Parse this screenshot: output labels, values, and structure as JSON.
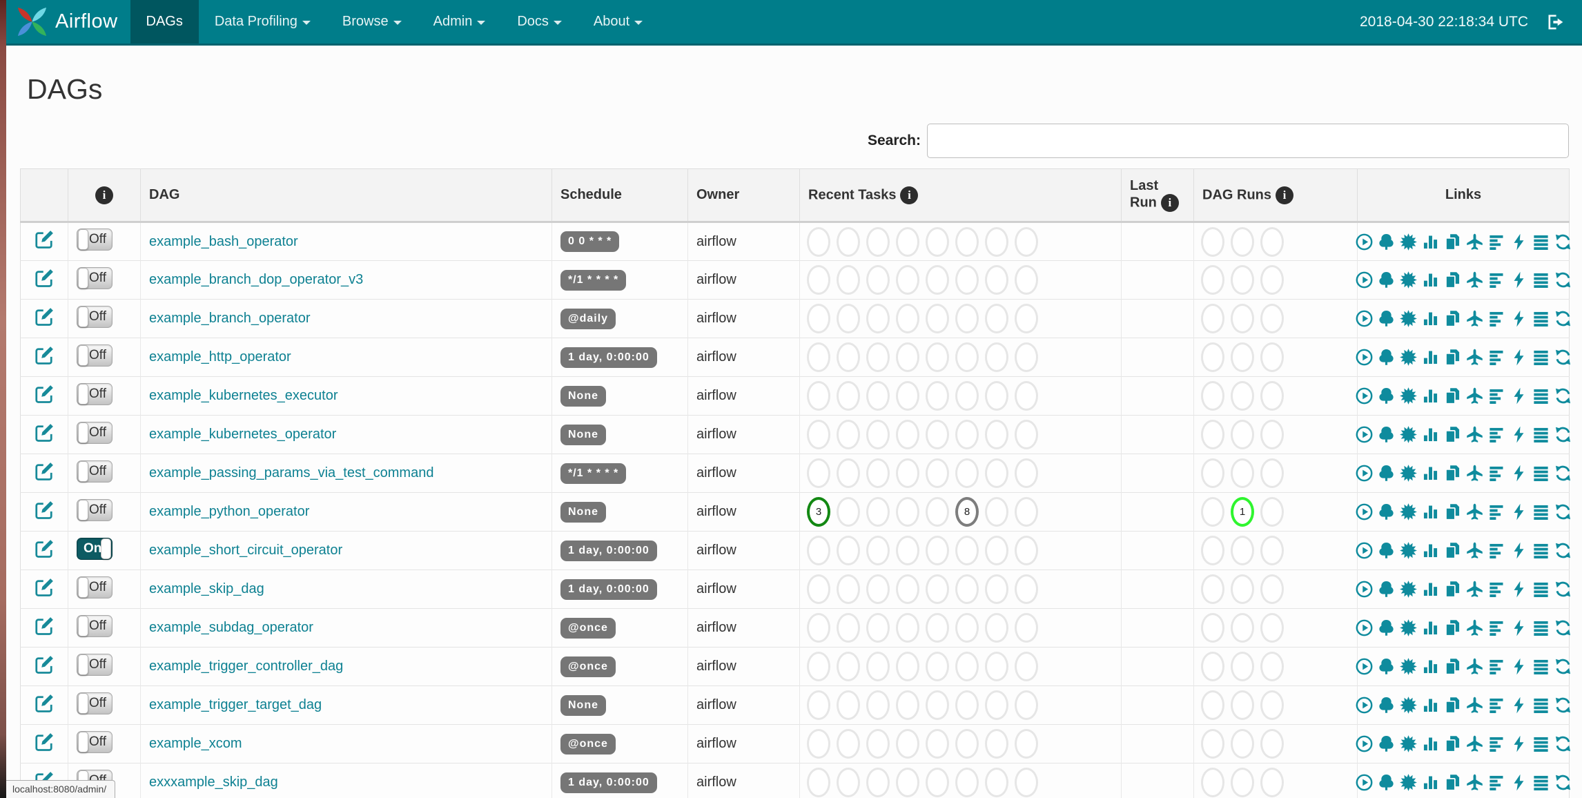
{
  "page": {
    "title": "DAGs",
    "status_bar_url": "localhost:8080/admin/"
  },
  "navbar": {
    "brand": "Airflow",
    "items": [
      {
        "label": "DAGs",
        "active": true,
        "caret": false
      },
      {
        "label": "Data Profiling",
        "active": false,
        "caret": true
      },
      {
        "label": "Browse",
        "active": false,
        "caret": true
      },
      {
        "label": "Admin",
        "active": false,
        "caret": true
      },
      {
        "label": "Docs",
        "active": false,
        "caret": true
      },
      {
        "label": "About",
        "active": false,
        "caret": true
      }
    ],
    "clock": "2018-04-30 22:18:34 UTC",
    "colors": {
      "background": "#007d8a",
      "active_background": "#00565f"
    }
  },
  "search": {
    "label": "Search:",
    "value": ""
  },
  "table": {
    "headers": {
      "dag": "DAG",
      "schedule": "Schedule",
      "owner": "Owner",
      "recent_tasks": "Recent Tasks",
      "last_run": "Last Run",
      "dag_runs": "DAG Runs",
      "links": "Links"
    },
    "toggle_labels": {
      "on": "On",
      "off": "Off"
    },
    "recent_task_slots": 8,
    "dag_run_slots": 3,
    "links": [
      {
        "name": "trigger-dag",
        "icon": "play-circle"
      },
      {
        "name": "tree-view",
        "icon": "tree"
      },
      {
        "name": "graph-view",
        "icon": "sun"
      },
      {
        "name": "task-duration",
        "icon": "bar-chart"
      },
      {
        "name": "task-tries",
        "icon": "copy"
      },
      {
        "name": "landing-times",
        "icon": "plane"
      },
      {
        "name": "gantt-view",
        "icon": "gantt"
      },
      {
        "name": "code-view",
        "icon": "bolt"
      },
      {
        "name": "logs",
        "icon": "menu"
      },
      {
        "name": "refresh",
        "icon": "refresh"
      }
    ],
    "state_colors": {
      "success": "#138813",
      "queued": "#7d7d7d",
      "running": "#2ff52f",
      "empty": "#e6e6e6"
    },
    "rows": [
      {
        "dag": "example_bash_operator",
        "schedule": "0 0 * * *",
        "owner": "airflow",
        "enabled": false,
        "recent_tasks": [],
        "dag_runs": []
      },
      {
        "dag": "example_branch_dop_operator_v3",
        "schedule": "*/1 * * * *",
        "owner": "airflow",
        "enabled": false,
        "recent_tasks": [],
        "dag_runs": []
      },
      {
        "dag": "example_branch_operator",
        "schedule": "@daily",
        "owner": "airflow",
        "enabled": false,
        "recent_tasks": [],
        "dag_runs": []
      },
      {
        "dag": "example_http_operator",
        "schedule": "1 day, 0:00:00",
        "owner": "airflow",
        "enabled": false,
        "recent_tasks": [],
        "dag_runs": []
      },
      {
        "dag": "example_kubernetes_executor",
        "schedule": "None",
        "owner": "airflow",
        "enabled": false,
        "recent_tasks": [],
        "dag_runs": []
      },
      {
        "dag": "example_kubernetes_operator",
        "schedule": "None",
        "owner": "airflow",
        "enabled": false,
        "recent_tasks": [],
        "dag_runs": []
      },
      {
        "dag": "example_passing_params_via_test_command",
        "schedule": "*/1 * * * *",
        "owner": "airflow",
        "enabled": false,
        "recent_tasks": [],
        "dag_runs": []
      },
      {
        "dag": "example_python_operator",
        "schedule": "None",
        "owner": "airflow",
        "enabled": false,
        "recent_tasks": [
          {
            "slot": 1,
            "count": "3",
            "state": "success",
            "color": "#138813"
          },
          {
            "slot": 6,
            "count": "8",
            "state": "queued",
            "color": "#7d7d7d"
          }
        ],
        "dag_runs": [
          {
            "slot": 2,
            "count": "1",
            "state": "running",
            "color": "#2ff52f"
          }
        ]
      },
      {
        "dag": "example_short_circuit_operator",
        "schedule": "1 day, 0:00:00",
        "owner": "airflow",
        "enabled": true,
        "recent_tasks": [],
        "dag_runs": []
      },
      {
        "dag": "example_skip_dag",
        "schedule": "1 day, 0:00:00",
        "owner": "airflow",
        "enabled": false,
        "recent_tasks": [],
        "dag_runs": []
      },
      {
        "dag": "example_subdag_operator",
        "schedule": "@once",
        "owner": "airflow",
        "enabled": false,
        "recent_tasks": [],
        "dag_runs": []
      },
      {
        "dag": "example_trigger_controller_dag",
        "schedule": "@once",
        "owner": "airflow",
        "enabled": false,
        "recent_tasks": [],
        "dag_runs": []
      },
      {
        "dag": "example_trigger_target_dag",
        "schedule": "None",
        "owner": "airflow",
        "enabled": false,
        "recent_tasks": [],
        "dag_runs": []
      },
      {
        "dag": "example_xcom",
        "schedule": "@once",
        "owner": "airflow",
        "enabled": false,
        "recent_tasks": [],
        "dag_runs": []
      },
      {
        "dag": "exxxample_skip_dag",
        "schedule": "1 day, 0:00:00",
        "owner": "airflow",
        "enabled": false,
        "recent_tasks": [],
        "dag_runs": []
      }
    ]
  }
}
